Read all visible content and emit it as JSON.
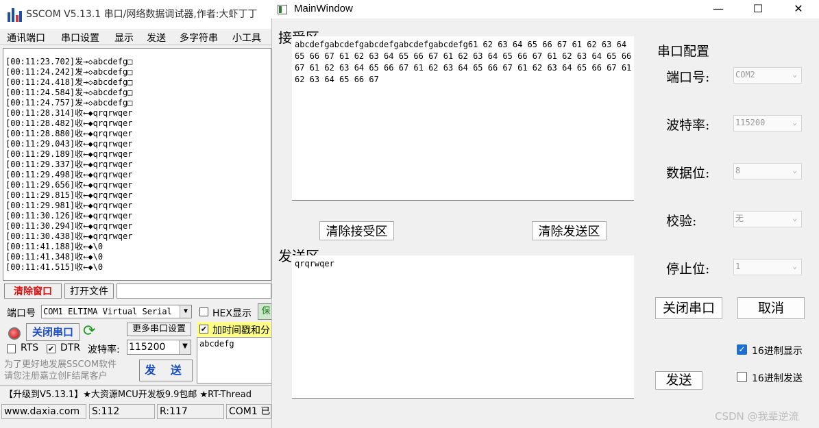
{
  "sscom": {
    "title": "SSCOM V5.13.1 串口/网络数据调试器,作者:大虾丁丁",
    "menu": [
      "通讯端口",
      "串口设置",
      "显示",
      "发送",
      "多字符串",
      "小工具"
    ],
    "log_lines": [
      "[00:11:23.702]发→◇abcdefg□",
      "[00:11:24.242]发→◇abcdefg□",
      "[00:11:24.418]发→◇abcdefg□",
      "[00:11:24.584]发→◇abcdefg□",
      "[00:11:24.757]发→◇abcdefg□",
      "[00:11:28.314]收←◆qrqrwqer",
      "[00:11:28.482]收←◆qrqrwqer",
      "[00:11:28.880]收←◆qrqrwqer",
      "[00:11:29.043]收←◆qrqrwqer",
      "[00:11:29.189]收←◆qrqrwqer",
      "[00:11:29.337]收←◆qrqrwqer",
      "[00:11:29.498]收←◆qrqrwqer",
      "[00:11:29.656]收←◆qrqrwqer",
      "[00:11:29.815]收←◆qrqrwqer",
      "[00:11:29.981]收←◆qrqrwqer",
      "[00:11:30.126]收←◆qrqrwqer",
      "[00:11:30.294]收←◆qrqrwqer",
      "[00:11:30.438]收←◆qrqrwqer",
      "[00:11:41.188]收←◆\\0",
      "[00:11:41.348]收←◆\\0",
      "[00:11:41.515]收←◆\\0"
    ],
    "clear_window": "清除窗口",
    "open_file": "打开文件",
    "port_label": "端口号",
    "port_value": "COM1 ELTIMA Virtual Serial",
    "hex_show": "HEX显示",
    "hex_show_right": "保",
    "close_port": "关闭串口",
    "more_settings": "更多串口设置",
    "timestamp_label": "加时间戳和分",
    "rts": "RTS",
    "dtr": "DTR",
    "baud_label": "波特率:",
    "baud_value": "115200",
    "send_text": "abcdefg",
    "promo": "为了更好地发展SSCOM软件\n请您注册嘉立创F结尾客户",
    "send_btn": "发 送",
    "ad": "【升级到V5.13.1】★大资源MCU开发板9.9包邮 ★RT-Thread",
    "status": [
      "www.daxia.com",
      "S:112",
      "R:117",
      "COM1 已"
    ]
  },
  "main": {
    "title": "MainWindow",
    "receive_label": "接受区",
    "receive_text": "abcdefgabcdefgabcdefgabcdefgabcdefg61 62 63 64 65 66 67 61 62 63 64 65 66 67 61 62 63 64 65 66 67 61 62 63 64 65 66 67 61 62 63 64 65 66 67 61 62 63 64 65 66 67 61 62 63 64 65 66 67 61 62 63 64 65 66 67 61 62 63 64 65 66 67",
    "clear_receive": "清除接受区",
    "clear_send": "清除发送区",
    "send_label": "发送区",
    "send_text": "qrqrwqer",
    "send_btn": "发送",
    "config_title": "串口配置",
    "config": [
      {
        "label": "端口号:",
        "value": "COM2"
      },
      {
        "label": "波特率:",
        "value": "115200"
      },
      {
        "label": "数据位:",
        "value": "8"
      },
      {
        "label": "校验:",
        "value": "无"
      },
      {
        "label": "停止位:",
        "value": "1"
      }
    ],
    "close_port": "关闭串口",
    "cancel": "取消",
    "hex_display": "16进制显示",
    "hex_display_checked": true,
    "hex_send": "16进制发送",
    "hex_send_checked": false
  },
  "watermark": "CSDN @我辈逆流"
}
